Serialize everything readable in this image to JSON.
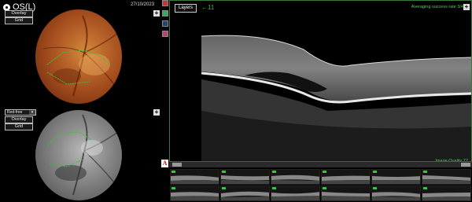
{
  "header": {
    "eye_label": "OS(L)",
    "date": "27/10/2023"
  },
  "fundus_top": {
    "buttons": [
      "Overlay",
      "Grid"
    ],
    "plus": "+"
  },
  "fundus_bottom": {
    "mode_select": "Red-free",
    "buttons": [
      "Overlay",
      "Grid"
    ],
    "plus": "+"
  },
  "oct": {
    "layers_label": "Layers",
    "layers_arrow": "←11",
    "averaging_text": "Averaging success rate 3/4",
    "plus": "+",
    "quality_text": "Image Quality 77"
  },
  "badge": "A",
  "colors": {
    "accent_green": "#4fd04f",
    "border_green": "#3a7a3a"
  },
  "icons": [
    "eye-icon",
    "plus-icon",
    "dropdown-icon",
    "color-mode-icon",
    "green-mode-icon",
    "blue-mode-icon",
    "pink-mode-icon"
  ]
}
